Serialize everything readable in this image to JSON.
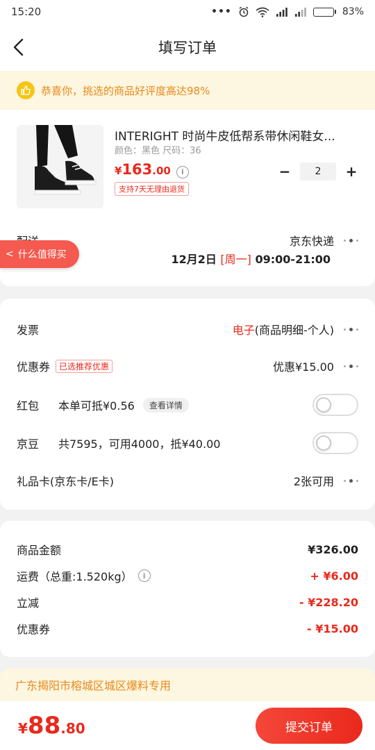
{
  "status_bar": {
    "time": "15:20",
    "dots": "•••",
    "battery": "83%",
    "battery_level": 0.83
  },
  "nav": {
    "title": "填写订单"
  },
  "promo": {
    "text": "恭喜你，挑选的商品好评度高达98%"
  },
  "product": {
    "title": "INTERIGHT 时尚牛皮低帮系带休闲鞋女...",
    "spec": "颜色：黑色   尺码：36",
    "price_symbol": "¥",
    "price_int": "163",
    "price_dec": ".00",
    "return_badge": "支持7天无理由退货",
    "quantity": "2",
    "minus": "−",
    "plus": "+"
  },
  "delivery": {
    "label": "配送",
    "method": "京东快递",
    "date": "12月2日",
    "weekday": "[周一]",
    "time": "09:00-21:00"
  },
  "float_tab": {
    "chevron": "<",
    "label": "什么值得买"
  },
  "options": {
    "invoice": {
      "label": "发票",
      "value_highlight": "电子",
      "value_rest": "(商品明细-个人)"
    },
    "coupon": {
      "label": "优惠券",
      "tag": "已选推荐优惠",
      "value": "优惠¥15.00"
    },
    "red_packet": {
      "label": "红包",
      "desc": "本单可抵¥0.56",
      "detail_chip": "查看详情",
      "enabled": false
    },
    "jingdou": {
      "label": "京豆",
      "desc": "共7595，可用4000，抵¥40.00",
      "enabled": false
    },
    "gift_card": {
      "label": "礼品卡(京东卡/E卡)",
      "value": "2张可用"
    }
  },
  "summary": {
    "rows": [
      {
        "label": "商品金额",
        "value": "¥326.00",
        "color": "#222222"
      },
      {
        "label": "运费（总重:1.520kg）",
        "value": "+ ¥6.00",
        "color": "#e8291c"
      },
      {
        "label": "立减",
        "value": "- ¥228.20",
        "color": "#e8291c"
      },
      {
        "label": "优惠券",
        "value": "- ¥15.00",
        "color": "#e8291c"
      }
    ]
  },
  "address": {
    "text": "广东揭阳市榕城区城区爆料专用"
  },
  "bottom": {
    "total_symbol": "¥",
    "total_int": "88",
    "total_dec": ".80",
    "submit_label": "提交订单"
  },
  "colors": {
    "accent": "#e8291c",
    "promo_text": "#e8891a",
    "promo_bg": "#fdf6e0"
  }
}
